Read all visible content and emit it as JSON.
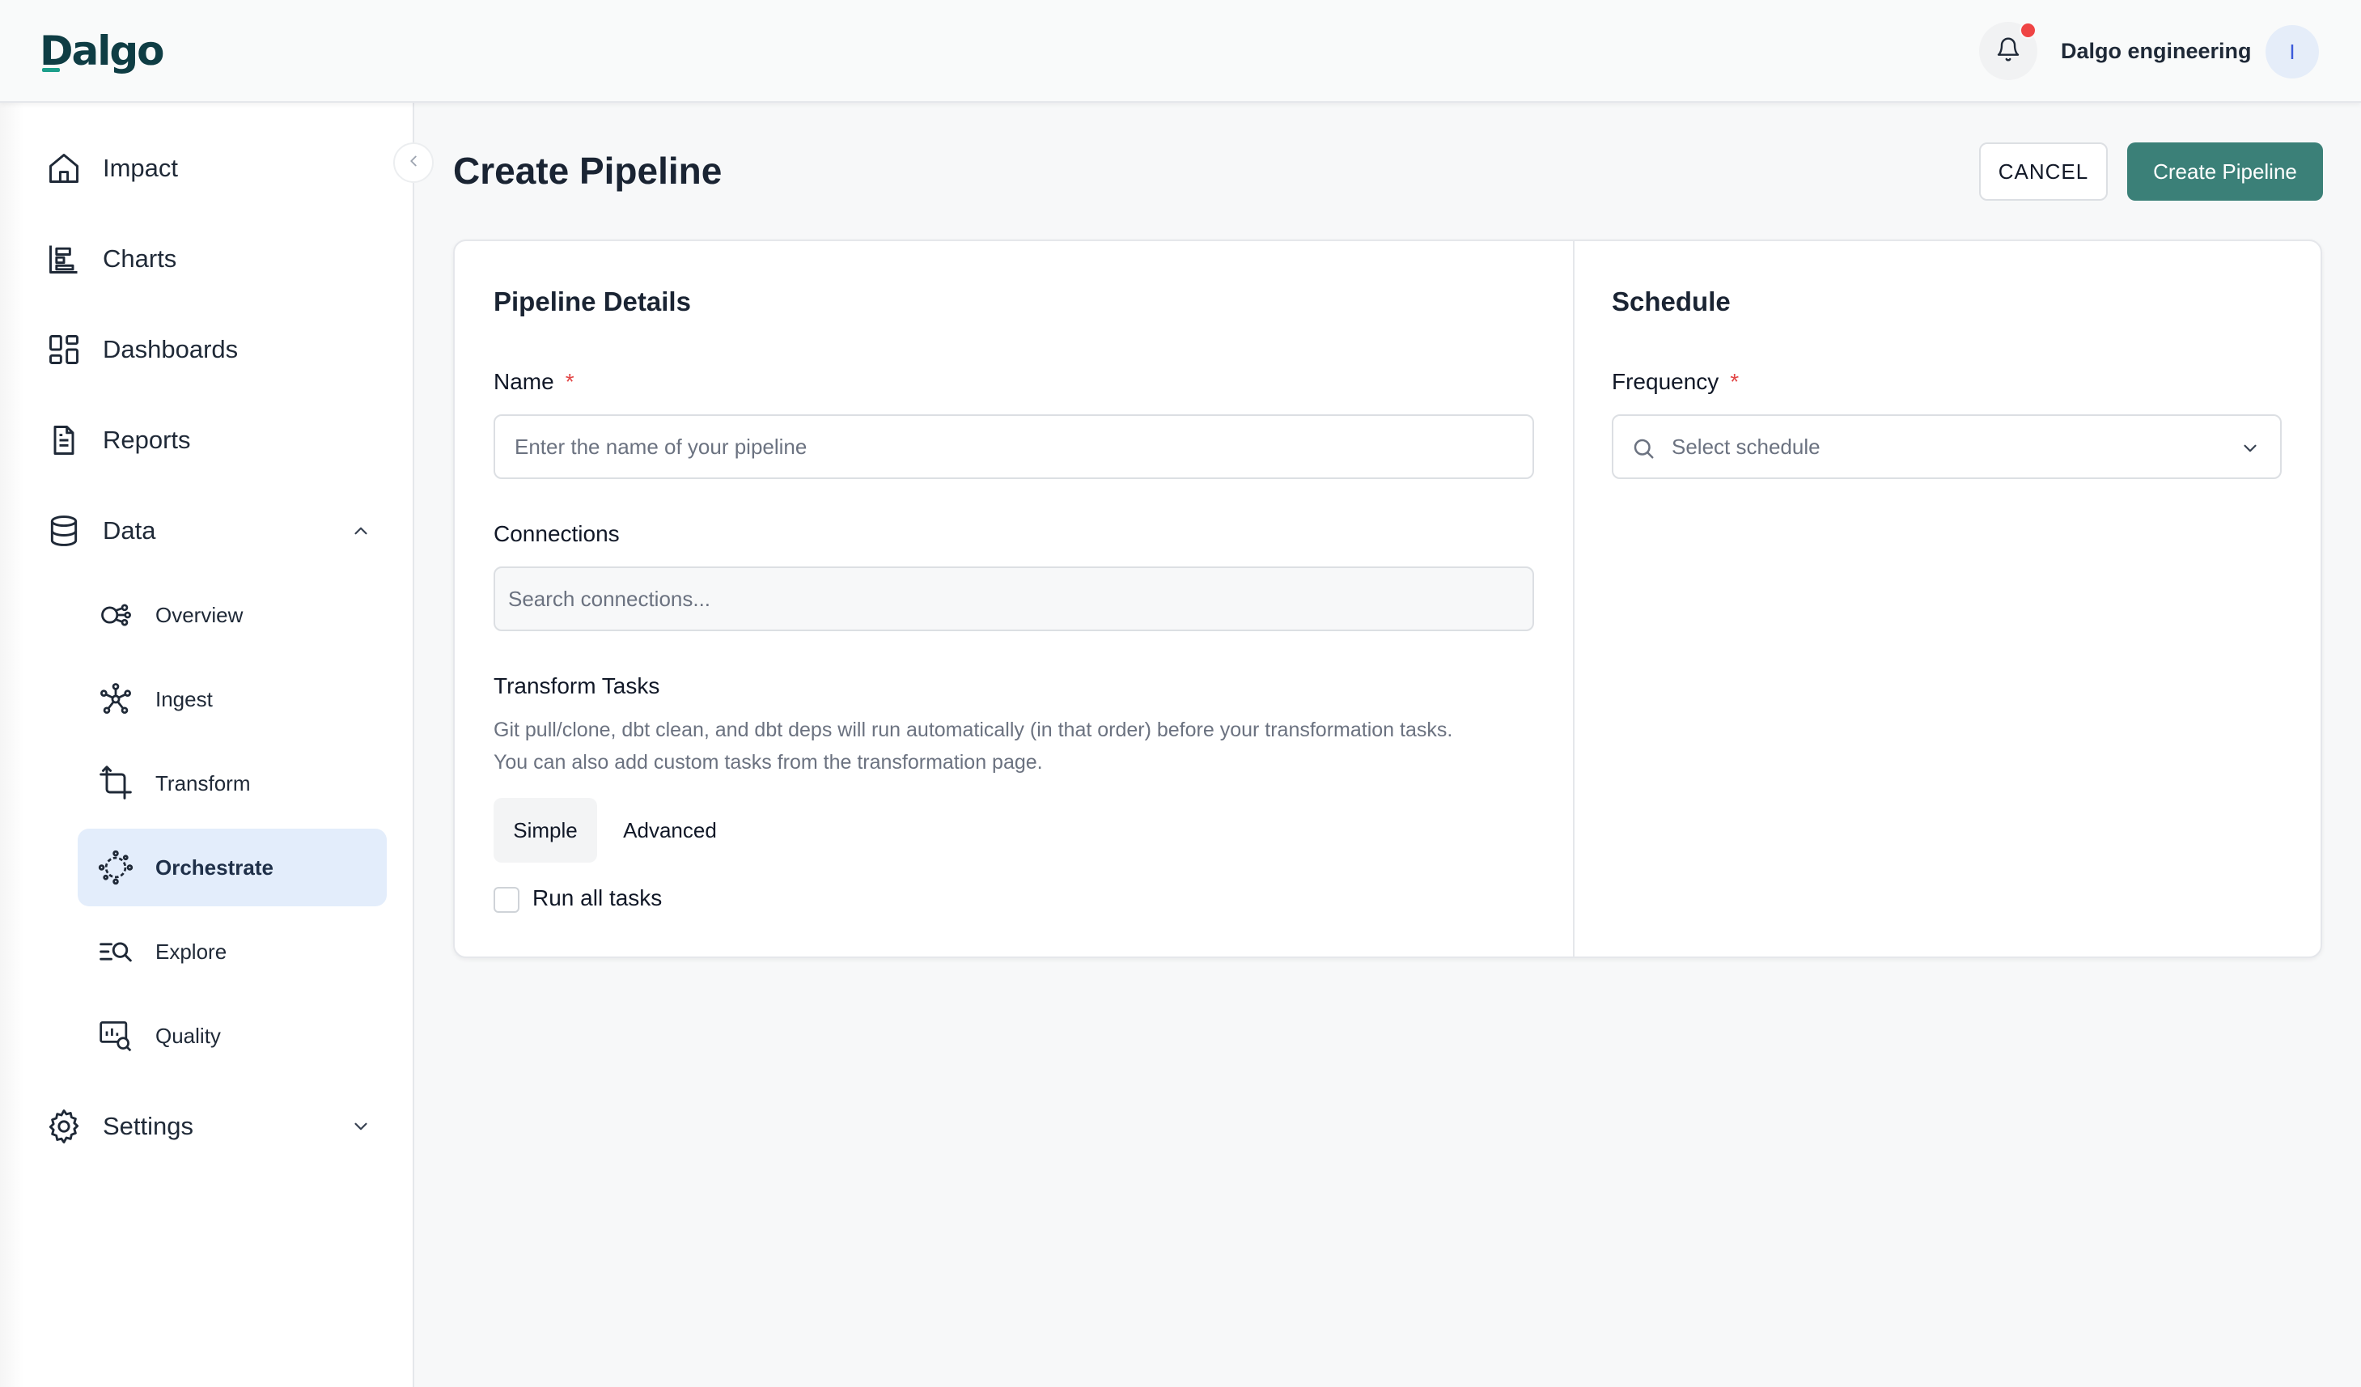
{
  "app": {
    "logo_text": "Dalgo",
    "org_name": "Dalgo engineering",
    "avatar_initial": "I"
  },
  "sidebar": {
    "items": [
      {
        "id": "impact",
        "label": "Impact",
        "icon": "home-icon"
      },
      {
        "id": "charts",
        "label": "Charts",
        "icon": "bar-chart-icon"
      },
      {
        "id": "dashboards",
        "label": "Dashboards",
        "icon": "dashboard-grid-icon"
      },
      {
        "id": "reports",
        "label": "Reports",
        "icon": "document-icon"
      },
      {
        "id": "data",
        "label": "Data",
        "icon": "database-icon",
        "expanded": true
      },
      {
        "id": "settings",
        "label": "Settings",
        "icon": "gear-icon",
        "expanded": false
      }
    ],
    "data_children": [
      {
        "id": "overview",
        "label": "Overview",
        "icon": "overview-icon"
      },
      {
        "id": "ingest",
        "label": "Ingest",
        "icon": "ingest-network-icon"
      },
      {
        "id": "transform",
        "label": "Transform",
        "icon": "transform-crop-icon"
      },
      {
        "id": "orchestrate",
        "label": "Orchestrate",
        "icon": "orchestrate-icon",
        "active": true
      },
      {
        "id": "explore",
        "label": "Explore",
        "icon": "explore-search-icon"
      },
      {
        "id": "quality",
        "label": "Quality",
        "icon": "quality-icon"
      }
    ]
  },
  "page": {
    "title": "Create Pipeline",
    "cancel_label": "CANCEL",
    "create_label": "Create Pipeline"
  },
  "pipeline_details": {
    "title": "Pipeline Details",
    "name_label": "Name",
    "required_mark": "*",
    "name_placeholder": "Enter the name of your pipeline",
    "connections_label": "Connections",
    "connections_placeholder": "Search connections...",
    "transform_label": "Transform Tasks",
    "transform_help_line1": "Git pull/clone, dbt clean, and dbt deps will run automatically (in that order) before your transformation tasks.",
    "transform_help_line2": "You can also add custom tasks from the transformation page.",
    "tabs": [
      "Simple",
      "Advanced"
    ],
    "selected_tab": "Simple",
    "run_all_label": "Run all tasks",
    "run_all_checked": false
  },
  "schedule": {
    "title": "Schedule",
    "frequency_label": "Frequency",
    "required_mark": "*",
    "frequency_placeholder": "Select schedule"
  },
  "colors": {
    "primary": "#3b8078",
    "active_nav_bg": "#e3edfb",
    "required": "#e24646",
    "notification_dot": "#ef4444"
  }
}
